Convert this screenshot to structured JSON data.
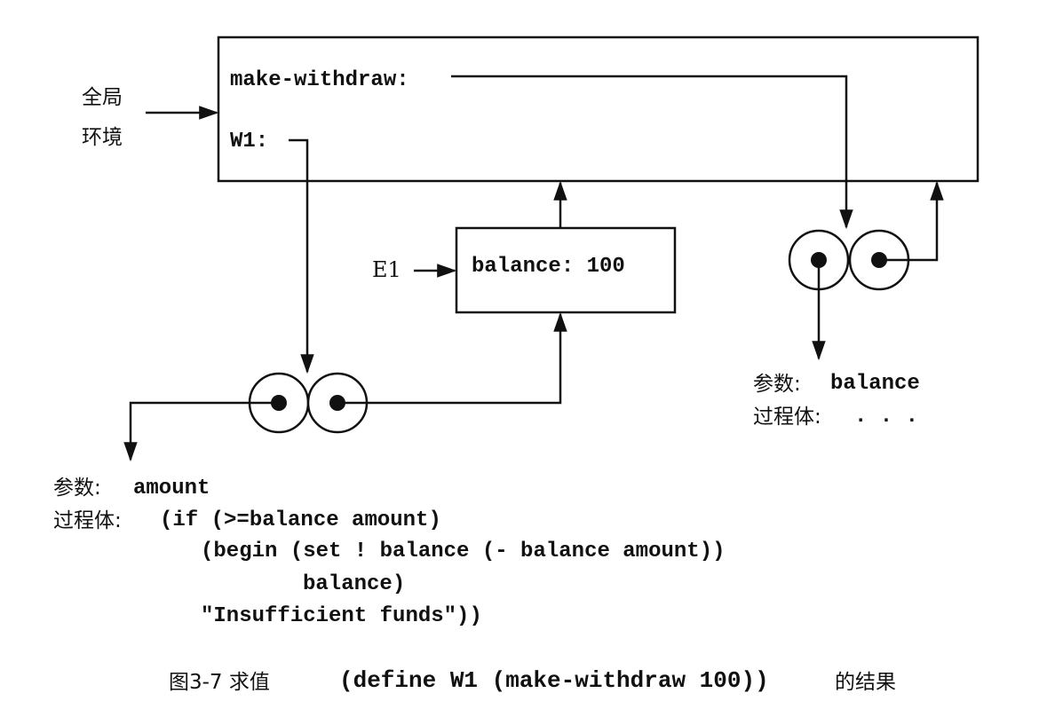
{
  "global_env": {
    "label_line1": "全局",
    "label_line2": "环境",
    "binding1": "make-withdraw:",
    "binding2": "W1:"
  },
  "e1_frame": {
    "label": "E1",
    "binding": "balance: 100"
  },
  "make_withdraw_proc": {
    "params_label": "参数:",
    "params_value": "balance",
    "body_label": "过程体:",
    "body_value": ". . ."
  },
  "w1_proc": {
    "params_label": "参数:",
    "params_value": "amount",
    "body_label": "过程体:",
    "body_lines": [
      "(if (>=balance amount)",
      "(begin (set ! balance (- balance amount))",
      "balance)",
      "\"Insufficient funds\"))"
    ]
  },
  "caption": {
    "prefix": "图3-7  求值",
    "code": "(define W1 (make-withdraw 100))",
    "suffix": "的结果"
  }
}
